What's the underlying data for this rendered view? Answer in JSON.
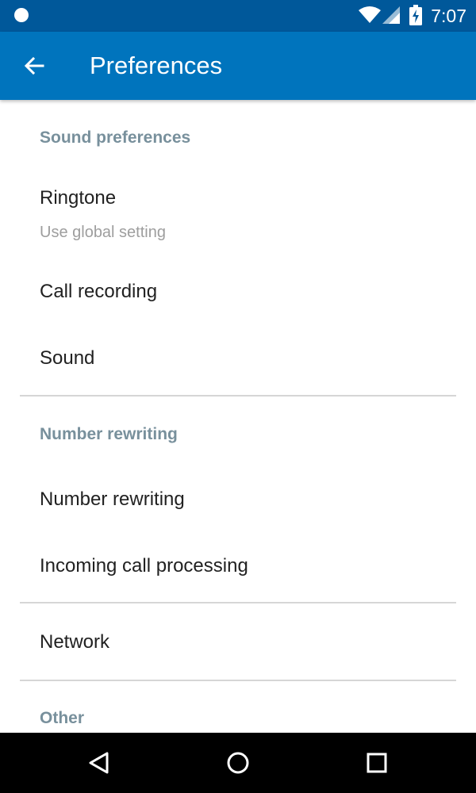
{
  "status_bar": {
    "time": "7:07",
    "icons": [
      "notification-dot-icon",
      "wifi-icon",
      "signal-icon",
      "battery-charging-icon"
    ]
  },
  "app_bar": {
    "title": "Preferences",
    "back_icon": "back-arrow-icon",
    "background": "#0074bd"
  },
  "sections": [
    {
      "header": "Sound preferences",
      "items": [
        {
          "title": "Ringtone",
          "summary": "Use global setting"
        },
        {
          "title": "Call recording"
        },
        {
          "title": "Sound"
        }
      ]
    },
    {
      "header": "Number rewriting",
      "items": [
        {
          "title": "Number rewriting"
        },
        {
          "title": "Incoming call processing"
        }
      ]
    },
    {
      "header": "",
      "items": [
        {
          "title": "Network"
        }
      ]
    },
    {
      "header": "Other",
      "items": []
    }
  ],
  "nav_bar": {
    "buttons": [
      "back-triangle-icon",
      "home-circle-icon",
      "recents-square-icon"
    ]
  },
  "colors": {
    "status_bar": "#00589a",
    "header_text": "#78909c",
    "primary_text": "#212121",
    "secondary_text": "#9e9e9e"
  }
}
